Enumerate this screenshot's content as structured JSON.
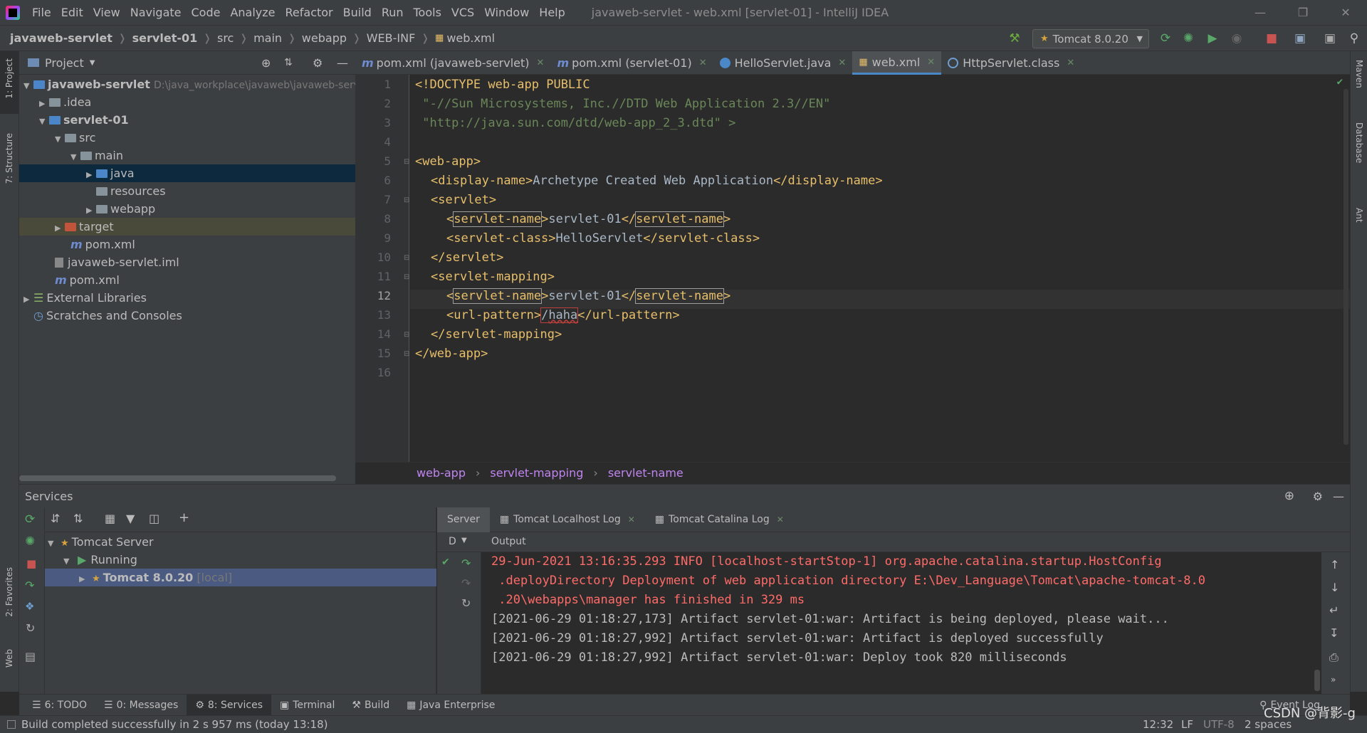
{
  "window": {
    "title": "javaweb-servlet - web.xml [servlet-01] - IntelliJ IDEA",
    "menu": [
      "File",
      "Edit",
      "View",
      "Navigate",
      "Code",
      "Analyze",
      "Refactor",
      "Build",
      "Run",
      "Tools",
      "VCS",
      "Window",
      "Help"
    ]
  },
  "breadcrumb": [
    "javaweb-servlet",
    "servlet-01",
    "src",
    "main",
    "webapp",
    "WEB-INF",
    "web.xml"
  ],
  "run_config": "Tomcat 8.0.20",
  "left_strip": {
    "project": "1: Project",
    "structure": "7: Structure",
    "favorites": "2: Favorites",
    "web": "Web"
  },
  "right_strip": {
    "maven": "Maven",
    "database": "Database",
    "ant": "Ant"
  },
  "project": {
    "header": "Project",
    "tree": [
      {
        "label": "javaweb-servlet",
        "path": "D:\\java_workplace\\javaweb\\javaweb-serv"
      },
      {
        "label": ".idea"
      },
      {
        "label": "servlet-01"
      },
      {
        "label": "src"
      },
      {
        "label": "main"
      },
      {
        "label": "java"
      },
      {
        "label": "resources"
      },
      {
        "label": "webapp"
      },
      {
        "label": "target"
      },
      {
        "label": "pom.xml"
      },
      {
        "label": "javaweb-servlet.iml"
      },
      {
        "label": "pom.xml"
      },
      {
        "label": "External Libraries"
      },
      {
        "label": "Scratches and Consoles"
      }
    ]
  },
  "tabs": [
    {
      "label": "pom.xml (javaweb-servlet)"
    },
    {
      "label": "pom.xml (servlet-01)"
    },
    {
      "label": "HelloServlet.java"
    },
    {
      "label": "web.xml"
    },
    {
      "label": "HttpServlet.class"
    }
  ],
  "code": {
    "line_numbers": [
      "1",
      "2",
      "3",
      "4",
      "5",
      "6",
      "7",
      "8",
      "9",
      "10",
      "11",
      "12",
      "13",
      "14",
      "15",
      "16"
    ],
    "l1": "<!DOCTYPE web-app PUBLIC",
    "l2": " \"-//Sun Microsystems, Inc.//DTD Web Application 2.3//EN\"",
    "l3": " \"http://java.sun.com/dtd/web-app_2_3.dtd\" >",
    "l5": "<web-app>",
    "l6_open": "<display-name>",
    "l6_text": "Archetype Created Web Application",
    "l6_close": "</display-name>",
    "l7": "<servlet>",
    "servlet_name_tag": "servlet-name",
    "servlet_name_value": "servlet-01",
    "l9_open": "<servlet-class>",
    "l9_text": "HelloServlet",
    "l9_close": "</servlet-class>",
    "l10": "</servlet>",
    "l11": "<servlet-mapping>",
    "l13_open": "<url-pattern>",
    "l13_slash": "/",
    "l13_text": "haha",
    "l13_close": "</url-pattern>",
    "l14": "</servlet-mapping>",
    "l15": "</web-app>"
  },
  "editor_breadcrumb": [
    "web-app",
    "servlet-mapping",
    "servlet-name"
  ],
  "services": {
    "title": "Services",
    "tree": [
      {
        "label": "Tomcat Server"
      },
      {
        "label": "Running"
      },
      {
        "label": "Tomcat 8.0.20",
        "suffix": "[local]"
      }
    ],
    "output_tabs": [
      "Server",
      "Tomcat Localhost Log",
      "Tomcat Catalina Log"
    ],
    "output_header": "Output",
    "deploy_label": "D",
    "log": [
      "29-Jun-2021 13:16:35.293 INFO [localhost-startStop-1] org.apache.catalina.startup.HostConfig",
      " .deployDirectory Deployment of web application directory E:\\Dev_Language\\Tomcat\\apache-tomcat-8.0",
      " .20\\webapps\\manager has finished in 329 ms",
      "[2021-06-29 01:18:27,173] Artifact servlet-01:war: Artifact is being deployed, please wait...",
      "[2021-06-29 01:18:27,992] Artifact servlet-01:war: Artifact is deployed successfully",
      "[2021-06-29 01:18:27,992] Artifact servlet-01:war: Deploy took 820 milliseconds"
    ]
  },
  "bottom_tabs": [
    "6: TODO",
    "0: Messages",
    "8: Services",
    "Terminal",
    "Build",
    "Java Enterprise"
  ],
  "event_log": "Event Log",
  "status": {
    "message": "Build completed successfully in 2 s 957 ms (today 13:18)",
    "position": "12:32",
    "line_sep": "LF",
    "encoding": "UTF-8",
    "indent": "2 spaces",
    "watermark": "CSDN @背影-g"
  }
}
